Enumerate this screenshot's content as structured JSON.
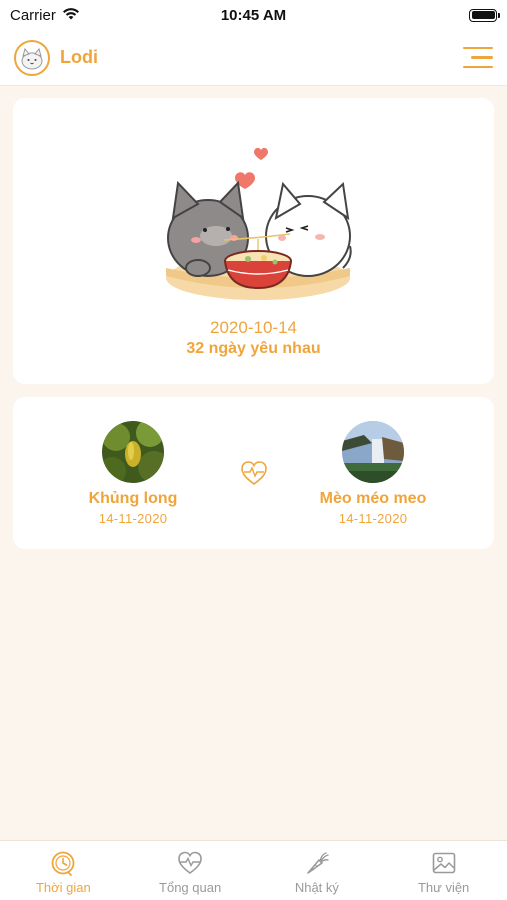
{
  "status_bar": {
    "carrier": "Carrier",
    "time": "10:45 AM"
  },
  "header": {
    "app_name": "Lodi"
  },
  "hero": {
    "start_date": "2020-10-14",
    "days_together": "32 ngày yêu nhau"
  },
  "couple": {
    "left": {
      "name": "Khủng long",
      "birthday": "14-11-2020"
    },
    "right": {
      "name": "Mèo méo meo",
      "birthday": "14-11-2020"
    }
  },
  "tabs": [
    {
      "label": "Thời gian",
      "icon": "clock-icon",
      "active": true
    },
    {
      "label": "Tổng quan",
      "icon": "heart-pulse-icon",
      "active": false
    },
    {
      "label": "Nhật ký",
      "icon": "carrot-pen-icon",
      "active": false
    },
    {
      "label": "Thư viện",
      "icon": "image-icon",
      "active": false
    }
  ],
  "colors": {
    "accent": "#f0a53c",
    "background": "#fcf5ee",
    "inactive": "#9a9a9a"
  }
}
